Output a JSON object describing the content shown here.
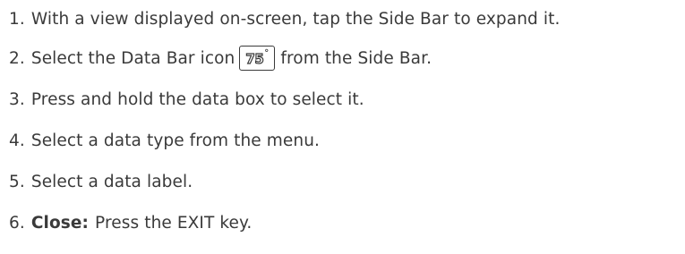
{
  "steps": [
    {
      "num": "1.",
      "text": "With a view displayed on-screen, tap the Side Bar to expand it."
    },
    {
      "num": "2.",
      "text_before": "Select the Data Bar icon",
      "icon_label": "75",
      "icon_degree": "°",
      "text_after": "from the Side Bar."
    },
    {
      "num": "3.",
      "text": "Press and hold the data box to select it."
    },
    {
      "num": "4.",
      "text": "Select a data type from the menu."
    },
    {
      "num": "5.",
      "text": "Select a data label."
    },
    {
      "num": "6.",
      "bold": "Close:",
      "text": "Press the EXIT key."
    }
  ],
  "icons": {
    "data_bar": "data-bar-75-degrees-icon"
  }
}
